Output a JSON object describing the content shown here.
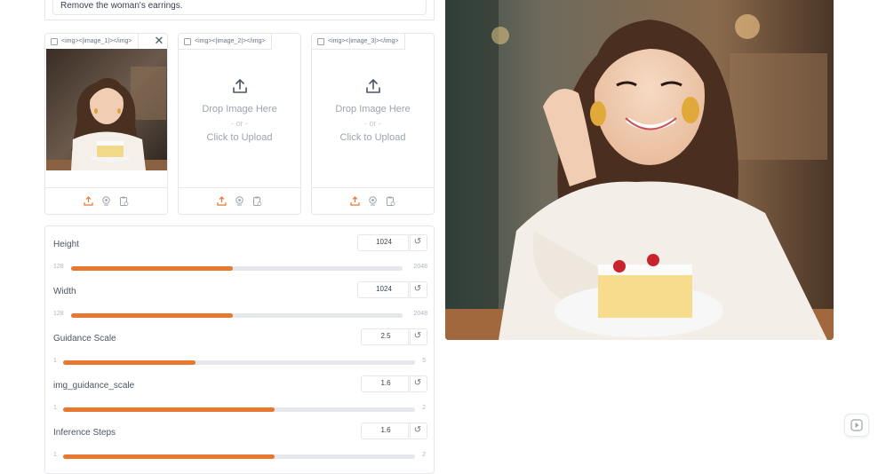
{
  "prompt": {
    "text": "Remove the woman's earrings."
  },
  "inputs": [
    {
      "label": "<img><|image_1|></img>",
      "has_image": true,
      "drop": "",
      "or": "",
      "upload": ""
    },
    {
      "label": "<img><|image_2|></img>",
      "has_image": false,
      "drop": "Drop Image Here",
      "or": "- or -",
      "upload": "Click to Upload"
    },
    {
      "label": "<img><|image_3|></img>",
      "has_image": false,
      "drop": "Drop Image Here",
      "or": "- or -",
      "upload": "Click to Upload"
    }
  ],
  "sliders": [
    {
      "label": "Height",
      "value": "1024",
      "min": "128",
      "max": "2048",
      "fraction": 0.487
    },
    {
      "label": "Width",
      "value": "1024",
      "min": "128",
      "max": "2048",
      "fraction": 0.487
    },
    {
      "label": "Guidance Scale",
      "value": "2.5",
      "min": "1",
      "max": "5",
      "fraction": 0.375
    },
    {
      "label": "img_guidance_scale",
      "value": "1.6",
      "min": "1",
      "max": "2",
      "fraction": 0.6
    },
    {
      "label": "Inference Steps",
      "value": "1.6",
      "min": "1",
      "max": "2",
      "fraction": 0.6
    }
  ],
  "icons": {
    "reset": "↺",
    "close": "✕",
    "upload": "upload-icon",
    "webcam": "webcam-icon",
    "clipboard": "clipboard-icon"
  },
  "colors": {
    "accent": "#e8782f",
    "border": "#e5e7eb"
  }
}
